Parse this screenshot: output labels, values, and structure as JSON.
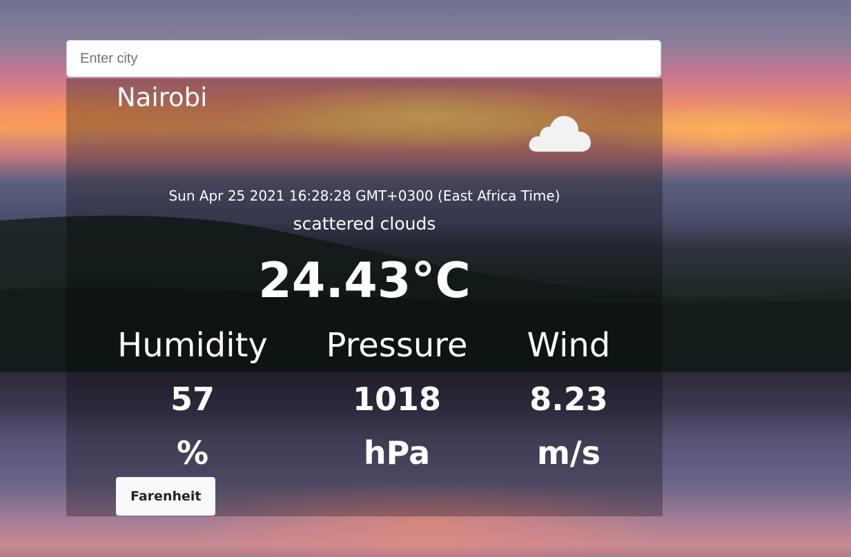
{
  "search": {
    "placeholder": "Enter city",
    "value": ""
  },
  "weather": {
    "city": "Nairobi",
    "icon": "cloud-icon",
    "date": "Sun Apr 25 2021 16:28:28 GMT+0300 (East Africa Time)",
    "description": "scattered clouds",
    "temperature": "24.43°C"
  },
  "stats": {
    "humidity": {
      "label": "Humidity",
      "value": "57",
      "unit": "%"
    },
    "pressure": {
      "label": "Pressure",
      "value": "1018",
      "unit": "hPa"
    },
    "wind": {
      "label": "Wind",
      "value": "8.23",
      "unit": "m/s"
    }
  },
  "unit_toggle": {
    "label": "Farenheit"
  },
  "colors": {
    "card_overlay": "rgba(0,0,0,0.28)",
    "text": "#ffffff",
    "button_bg": "#f8f9fa",
    "button_text": "#212529"
  }
}
